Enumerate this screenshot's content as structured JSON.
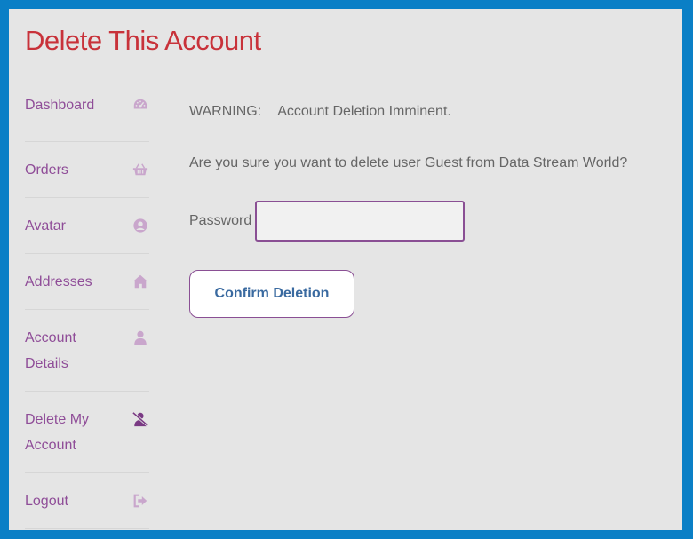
{
  "page": {
    "title": "Delete This Account"
  },
  "colors": {
    "frame_border": "#0a7fc6",
    "background": "#e5e5e5",
    "title": "#c8323a",
    "nav_link": "#8f4d98",
    "nav_icon": "#c9a6cc",
    "button_text": "#3a6aa0"
  },
  "sidebar": {
    "items": [
      {
        "label": "Dashboard",
        "icon": "dashboard-gauge-icon",
        "active": false
      },
      {
        "label": "Orders",
        "icon": "basket-icon",
        "active": false
      },
      {
        "label": "Avatar",
        "icon": "user-circle-icon",
        "active": false
      },
      {
        "label": "Addresses",
        "icon": "home-icon",
        "active": false
      },
      {
        "label": "Account Details",
        "icon": "user-icon",
        "active": false
      },
      {
        "label": "Delete My Account",
        "icon": "user-slash-icon",
        "active": true
      },
      {
        "label": "Logout",
        "icon": "sign-out-icon",
        "active": false
      }
    ]
  },
  "main": {
    "warning_label": "WARNING:",
    "warning_text": "Account Deletion Imminent.",
    "question": "Are you sure you want to delete user Guest from Data Stream World?",
    "password_label": "Password",
    "password_value": "",
    "confirm_button": "Confirm Deletion"
  }
}
